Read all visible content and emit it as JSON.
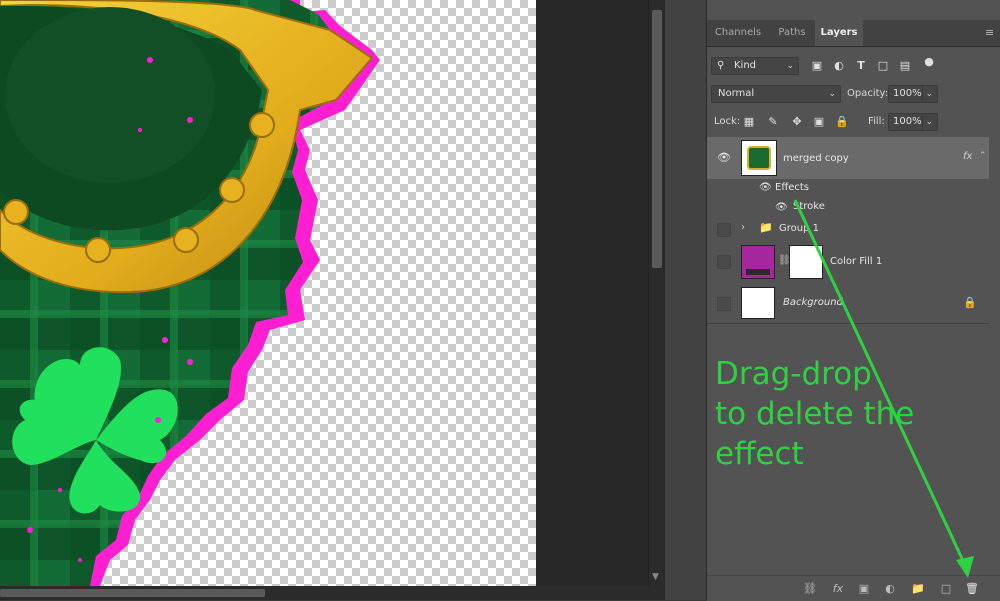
{
  "panel": {
    "tabs": [
      {
        "label": "Channels",
        "active": false
      },
      {
        "label": "Paths",
        "active": false
      },
      {
        "label": "Layers",
        "active": true
      }
    ],
    "filter": {
      "kind": "Kind"
    },
    "blend_mode": "Normal",
    "opacity_label": "Opacity:",
    "opacity_value": "100%",
    "lock_label": "Lock:",
    "fill_label": "Fill:",
    "fill_value": "100%"
  },
  "layers": [
    {
      "name": "merged copy",
      "fx": "fx",
      "effects_label": "Effects",
      "effect": "Stroke"
    },
    {
      "name": "Group 1"
    },
    {
      "name": "Color Fill 1",
      "swatch_color": "#a5279b"
    },
    {
      "name": "Background"
    }
  ],
  "annotation": {
    "lines": [
      "Drag-drop",
      "to delete the",
      "effect"
    ],
    "color": "#2fd143"
  },
  "icons": {
    "bottom": [
      "link-icon",
      "fx-icon",
      "mask-icon",
      "adjustment-icon",
      "folder-icon",
      "new-layer-icon",
      "trash-icon"
    ]
  },
  "colors": {
    "stroke_magenta": "#ff1ed2",
    "clover_green": "#20e05e",
    "horseshoe_gold": "#e9b722",
    "tartan_green": "#0f7a3a"
  }
}
